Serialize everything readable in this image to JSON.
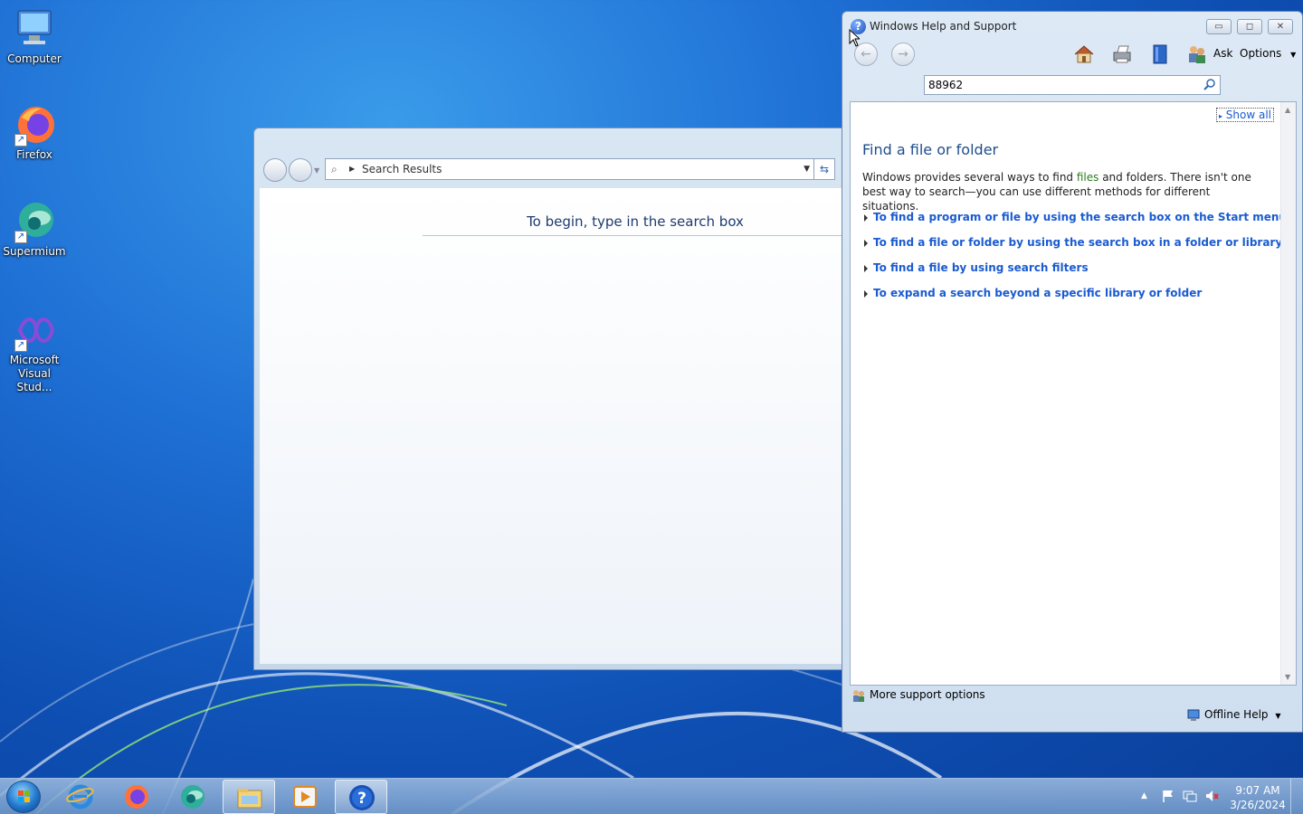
{
  "desktop": {
    "icons": [
      {
        "label": "Computer",
        "icon": "computer-icon"
      },
      {
        "label": "Firefox",
        "icon": "firefox-icon"
      },
      {
        "label": "Supermium",
        "icon": "supermium-icon"
      },
      {
        "label": "Microsoft Visual Stud...",
        "icon": "visual-studio-icon"
      }
    ]
  },
  "explorer": {
    "address": "Search Results",
    "empty_message": "To begin, type in the search box"
  },
  "help": {
    "title": "Windows Help and Support",
    "toolbar": {
      "ask": "Ask",
      "options": "Options"
    },
    "search_value": "88962",
    "show_all": "Show all",
    "heading": "Find a file or folder",
    "intro_pre": "Windows provides several ways to find ",
    "intro_highlight": "files",
    "intro_post": " and folders. There isn't one best way to search—you can use different methods for different situations.",
    "links": [
      "To find a program or file by using the search box on the Start menu",
      "To find a file or folder by using the search box in a folder or library",
      "To find a file by using search filters",
      "To expand a search beyond a specific library or folder"
    ],
    "more_support": "More support options",
    "offline_help": "Offline Help"
  },
  "taskbar": {
    "apps": [
      "internet-explorer-icon",
      "firefox-icon",
      "supermium-icon",
      "file-explorer-icon",
      "media-player-icon",
      "help-icon"
    ],
    "time": "9:07 AM",
    "date": "3/26/2024"
  },
  "colors": {
    "link": "#1a5bd0",
    "heading": "#1e4e8c"
  }
}
